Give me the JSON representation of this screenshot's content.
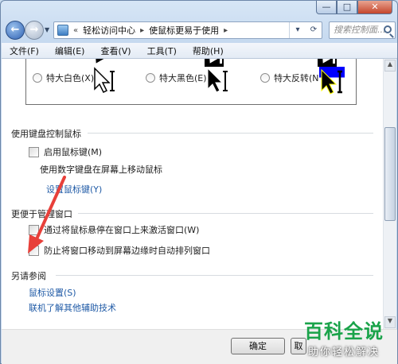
{
  "window": {
    "caption_buttons": {
      "minimize": "—",
      "maximize": "□",
      "close": "✕"
    }
  },
  "nav": {
    "back_icon": "back-arrow-icon",
    "forward_icon": "forward-arrow-icon",
    "breadcrumb_sep": "«",
    "breadcrumbs": [
      "轻松访问中心",
      "使鼠标更易于使用"
    ],
    "crumb_sep": "▸",
    "address_dropdown": "▾",
    "refresh": "⟳",
    "search_placeholder": "搜索控制面..."
  },
  "menu": [
    "文件(F)",
    "编辑(E)",
    "查看(V)",
    "工具(T)",
    "帮助(H)"
  ],
  "pointers": {
    "row1": [
      "特大白色(X)",
      "特大黑色(E)",
      "特大反转(N)"
    ]
  },
  "keyboard_section": {
    "heading": "使用键盘控制鼠标",
    "checkbox_label": "启用鼠标键(M)",
    "description": "使用数字键盘在屏幕上移动鼠标",
    "link": "设置鼠标键(Y)"
  },
  "window_mgmt_section": {
    "heading": "更便于管理窗口",
    "hover_label": "通过将鼠标悬停在窗口上来激活窗口(W)",
    "snap_label": "防止将窗口移动到屏幕边缘时自动排列窗口"
  },
  "see_also": {
    "heading": "另请参阅",
    "links": [
      "鼠标设置(S)",
      "联机了解其他辅助技术"
    ]
  },
  "footer": {
    "ok": "确定",
    "cancel": "取"
  },
  "watermark": {
    "big": "百科全说",
    "small": "助你轻松解决"
  },
  "colors": {
    "link": "#1f5aa6",
    "annotation_arrow": "#e8403a",
    "watermark": "#1aa34a"
  }
}
